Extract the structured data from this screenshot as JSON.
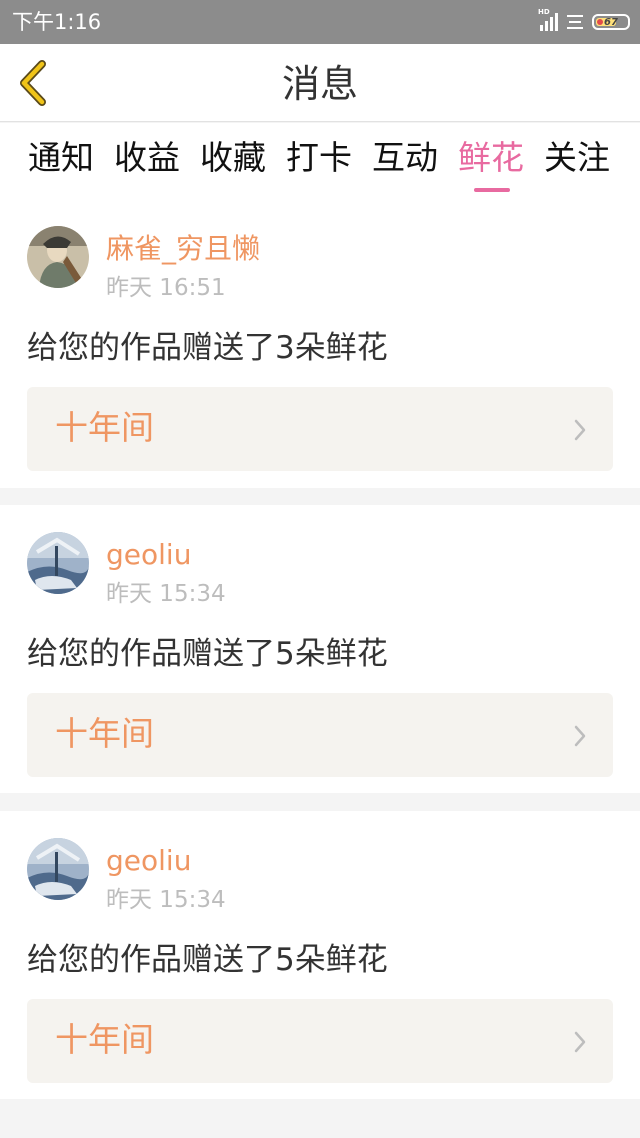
{
  "status_bar": {
    "time": "下午1:16",
    "network_label": "HD",
    "battery_level": "67",
    "icons": [
      "signal-icon",
      "wifi-icon",
      "battery-icon"
    ]
  },
  "header": {
    "title": "消息",
    "back_icon": "chevron-left-icon"
  },
  "tabs": [
    {
      "label": "通知",
      "active": false
    },
    {
      "label": "收益",
      "active": false
    },
    {
      "label": "收藏",
      "active": false
    },
    {
      "label": "打卡",
      "active": false
    },
    {
      "label": "互动",
      "active": false
    },
    {
      "label": "鲜花",
      "active": true
    },
    {
      "label": "关注",
      "active": false
    }
  ],
  "messages": [
    {
      "user": "麻雀_穷且懒",
      "time": "昨天 16:51",
      "text": "给您的作品赠送了3朵鲜花",
      "work": "十年间"
    },
    {
      "user": "geoliu",
      "time": "昨天 15:34",
      "text": "给您的作品赠送了5朵鲜花",
      "work": "十年间"
    },
    {
      "user": "geoliu",
      "time": "昨天 15:34",
      "text": "给您的作品赠送了5朵鲜花",
      "work": "十年间"
    }
  ],
  "colors": {
    "accent_pink": "#e86aa0",
    "username_orange": "#ef9662",
    "back_arrow_yellow": "#f0c419",
    "status_bar": "#8c8c8c"
  }
}
